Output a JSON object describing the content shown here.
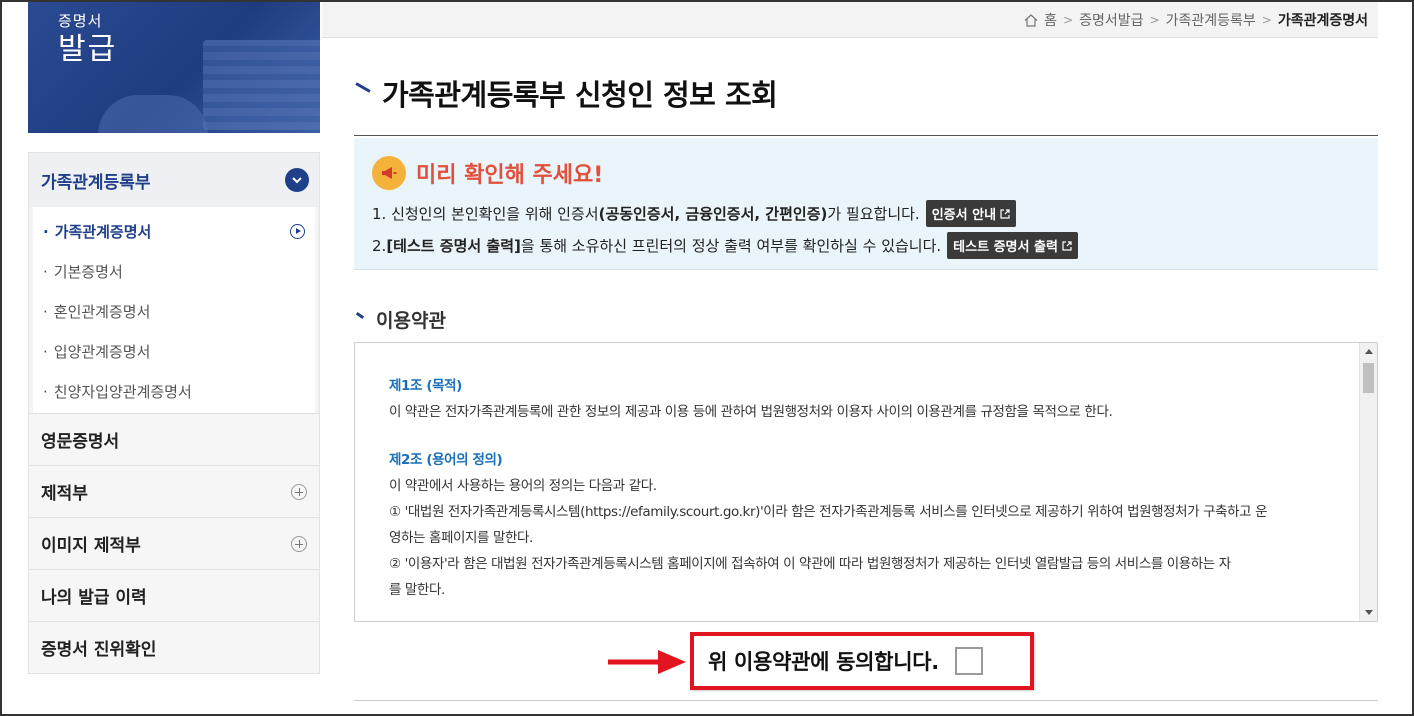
{
  "banner": {
    "line1": "증명서",
    "line2": "발급"
  },
  "breadcrumb": {
    "home": "홈",
    "items": [
      "증명서발급",
      "가족관계등록부"
    ],
    "current": "가족관계증명서"
  },
  "page_title": "가족관계등록부 신청인 정보 조회",
  "sidebar": {
    "top": "가족관계등록부",
    "sub_items": [
      {
        "label": "가족관계증명서",
        "active": true
      },
      {
        "label": "기본증명서"
      },
      {
        "label": "혼인관계증명서"
      },
      {
        "label": "입양관계증명서"
      },
      {
        "label": "친양자입양관계증명서"
      }
    ],
    "main_items": [
      {
        "label": "영문증명서"
      },
      {
        "label": "제적부"
      },
      {
        "label": "이미지 제적부"
      },
      {
        "label": "나의 발급 이력"
      },
      {
        "label": "증명서 진위확인"
      }
    ]
  },
  "notice": {
    "title": "미리 확인해 주세요!",
    "line1_pre": "1. 신청인의 본인확인을 위해 인증서",
    "line1_bold": "(공동인증서, 금융인증서, 간편인증)",
    "line1_post": "가 필요합니다.",
    "line1_btn": "인증서 안내",
    "line2_pre": "2. ",
    "line2_bold": "[테스트 증명서 출력]",
    "line2_post": "을 통해 소유하신 프린터의 정상 출력 여부를 확인하실 수 있습니다.",
    "line2_btn": "테스트 증명서 출력"
  },
  "terms": {
    "section_title": "이용약관",
    "art1_title": "제1조 (목적)",
    "art1_text": "이 약관은 전자가족관계등록에 관한 정보의 제공과 이용 등에 관하여 법원행정처와 이용자 사이의 이용관계를 규정함을 목적으로 한다.",
    "art2_title": "제2조 (용어의 정의)",
    "art2_intro": "이 약관에서 사용하는 용어의 정의는 다음과 같다.",
    "art2_item1a": "① '대법원 전자가족관계등록시스템(https://efamily.scourt.go.kr)'이라 함은 전자가족관계등록 서비스를 인터넷으로 제공하기 위하여 법원행정처가 구축하고 운",
    "art2_item1b": "영하는 홈페이지를 말한다.",
    "art2_item2a": "② '이용자'라 함은 대법원 전자가족관계등록시스템 홈페이지에 접속하여 이 약관에 따라 법원행정처가 제공하는 인터넷 열람발급 등의 서비스를 이용하는 자",
    "art2_item2b": "를 말한다."
  },
  "agree": {
    "label": "위 이용약관에 동의합니다.",
    "checked": false
  },
  "colors": {
    "brand": "#1f3f8a",
    "accent_red": "#e0151f",
    "notice_title": "#e2503c",
    "link_blue": "#1a6fb8"
  }
}
